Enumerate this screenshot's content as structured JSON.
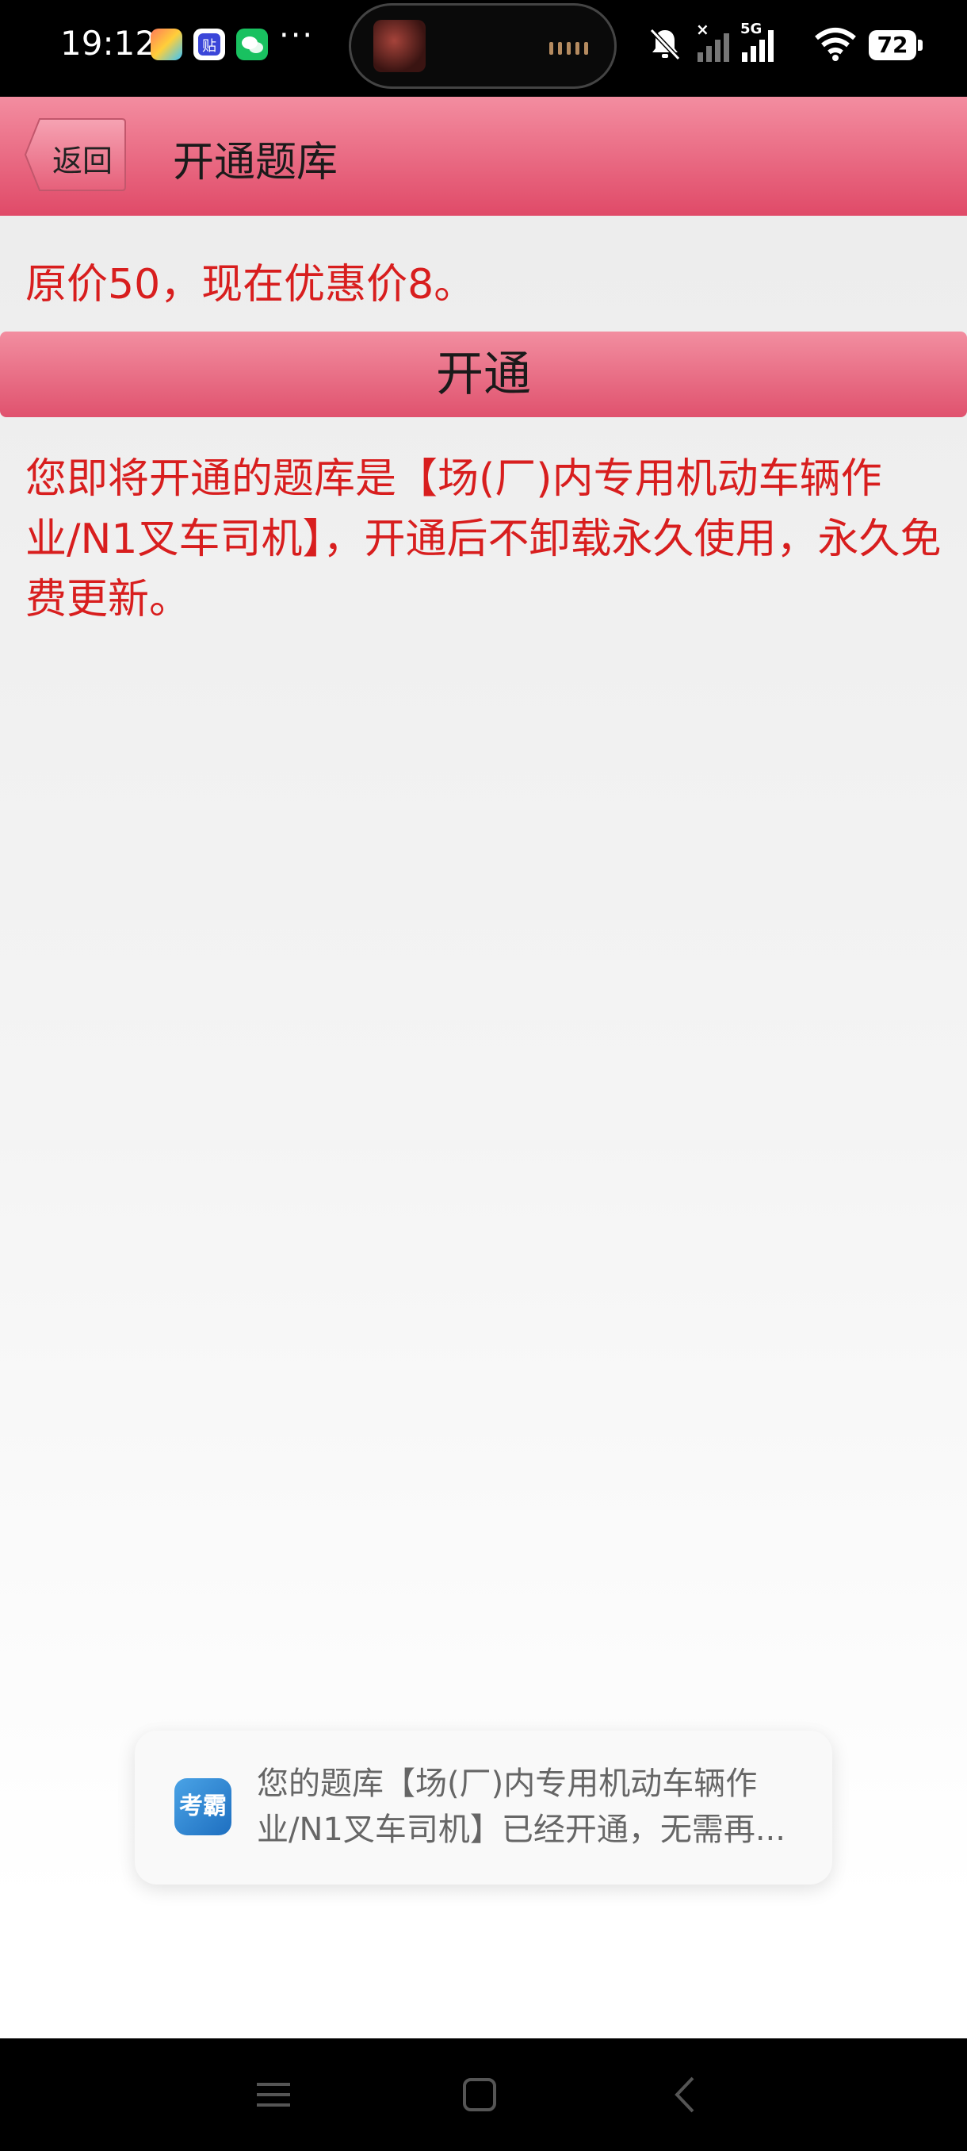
{
  "status_bar": {
    "time": "19:12",
    "overflow": "···",
    "network_label": "5G",
    "battery": "72",
    "icons": [
      "game-center-icon",
      "tieba-icon",
      "wechat-icon",
      "mute-icon",
      "no-signal-icon",
      "signal-icon",
      "wifi-icon"
    ]
  },
  "header": {
    "back_label": "返回",
    "title": "开通题库"
  },
  "main": {
    "price_text": "原价50，现在优惠价8。",
    "open_button_label": "开通",
    "description": "您即将开通的题库是【场(厂)内专用机动车辆作业/N1叉车司机】，开通后不卸载永久使用，永久免费更新。"
  },
  "toast": {
    "app_icon_text": "考霸",
    "message": "您的题库【场(厂)内专用机动车辆作业/N1叉车司机】已经开通，无需再..."
  },
  "colors": {
    "accent_top": "#f38da0",
    "accent_bottom": "#e04a68",
    "text_red": "#d81e1e"
  }
}
